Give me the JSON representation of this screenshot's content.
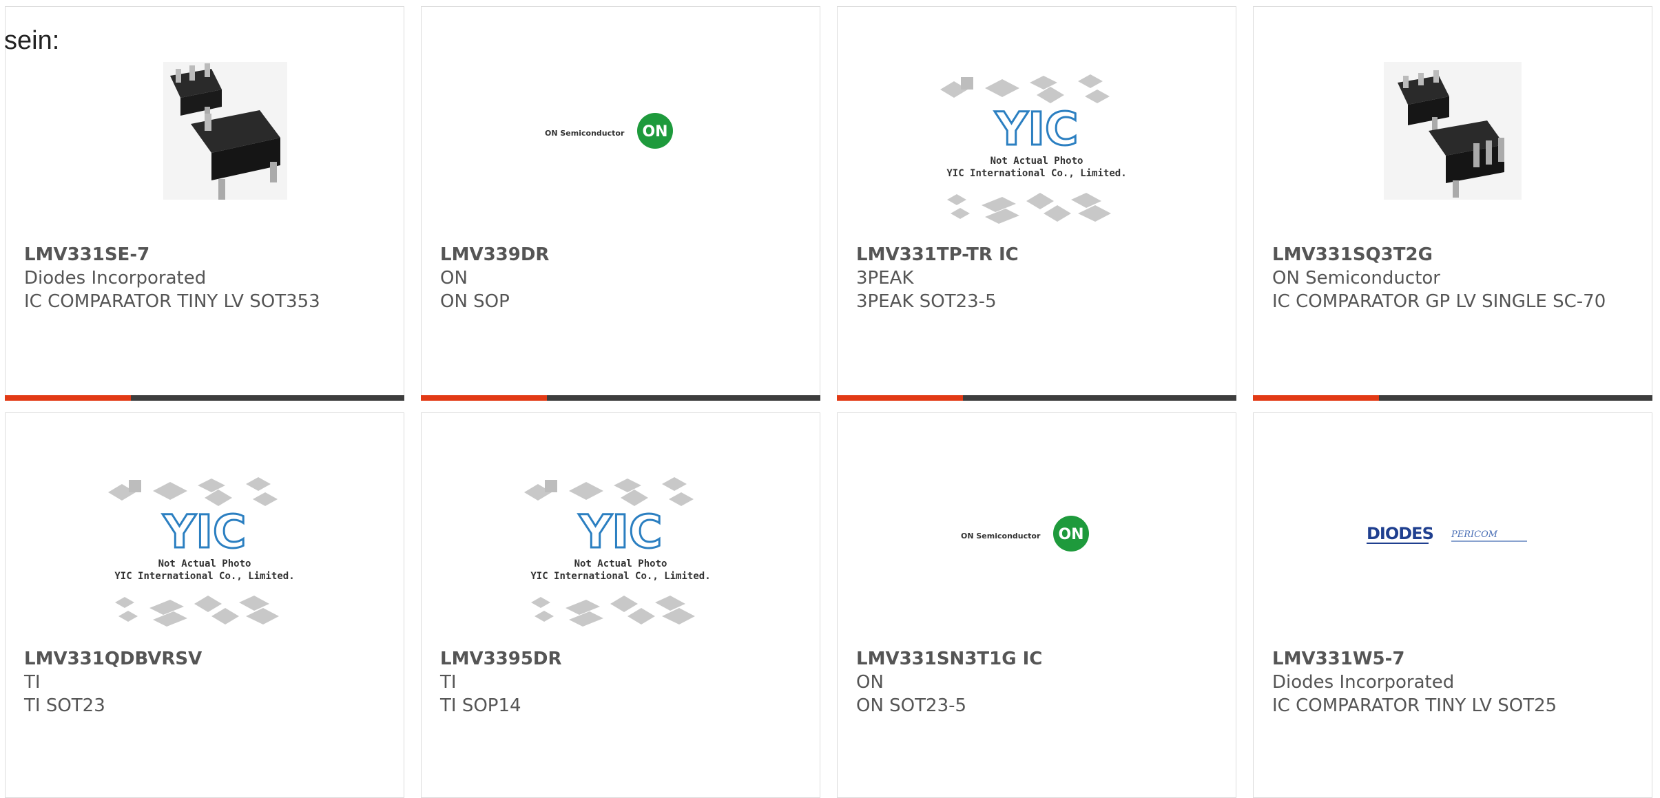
{
  "intro_text": "sein:",
  "products": [
    {
      "part": "LMV331SE-7",
      "maker": "Diodes Incorporated",
      "desc": "IC COMPARATOR TINY LV SOT353",
      "image": "chip-photo-sot353"
    },
    {
      "part": "LMV339DR",
      "maker": "ON",
      "desc": "ON SOP",
      "image": "on-semiconductor-logo"
    },
    {
      "part": "LMV331TP-TR IC",
      "maker": "3PEAK",
      "desc": "3PEAK SOT23-5",
      "image": "yic-placeholder"
    },
    {
      "part": "LMV331SQ3T2G",
      "maker": "ON Semiconductor",
      "desc": "IC COMPARATOR GP LV SINGLE SC-70",
      "image": "chip-photo-sc70"
    },
    {
      "part": "LMV331QDBVRSV",
      "maker": "TI",
      "desc": "TI SOT23",
      "image": "yic-placeholder"
    },
    {
      "part": "LMV3395DR",
      "maker": "TI",
      "desc": "TI SOP14",
      "image": "yic-placeholder"
    },
    {
      "part": "LMV331SN3T1G IC",
      "maker": "ON",
      "desc": "ON SOT23-5",
      "image": "on-semiconductor-logo"
    },
    {
      "part": "LMV331W5-7",
      "maker": "Diodes Incorporated",
      "desc": "IC COMPARATOR TINY LV SOT25",
      "image": "diodes-pericom-logo"
    }
  ],
  "logo_text": {
    "on_semi": "ON Semiconductor",
    "on_badge": "ON",
    "yic": "YIC",
    "yic_line1": "Not Actual Photo",
    "yic_line2": "YIC International Co., Limited.",
    "diodes": "DIODES",
    "pericom": "PERICOM"
  },
  "colors": {
    "accent": "#e23a15",
    "bar_dark": "#3d3d3d",
    "text": "#555555",
    "yic_blue": "#2b7fc1",
    "on_green": "#1e9a3c"
  }
}
